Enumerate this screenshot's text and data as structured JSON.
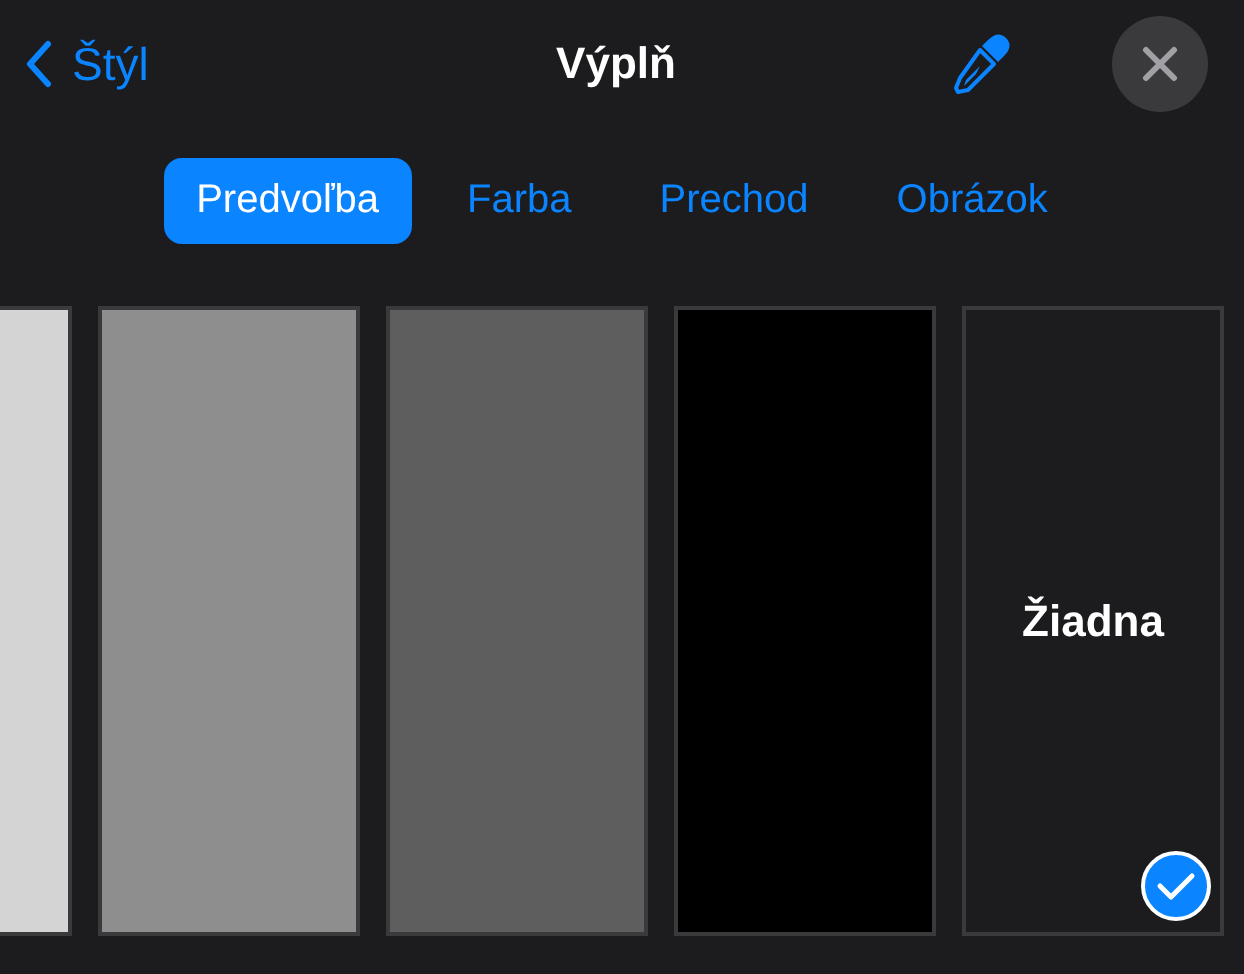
{
  "header": {
    "back": "Štýl",
    "title": "Výplň"
  },
  "tabs": [
    {
      "label": "Predvoľba",
      "selected": true
    },
    {
      "label": "Farba",
      "selected": false
    },
    {
      "label": "Prechod",
      "selected": false
    },
    {
      "label": "Obrázok",
      "selected": false
    }
  ],
  "swatches": [
    {
      "kind": "color",
      "color": "#d4d4d4",
      "selected": false
    },
    {
      "kind": "color",
      "color": "#8e8e8e",
      "selected": false
    },
    {
      "kind": "color",
      "color": "#5e5e5e",
      "selected": false
    },
    {
      "kind": "color",
      "color": "#000000",
      "selected": false
    },
    {
      "kind": "none",
      "label": "Žiadna",
      "selected": true
    }
  ]
}
